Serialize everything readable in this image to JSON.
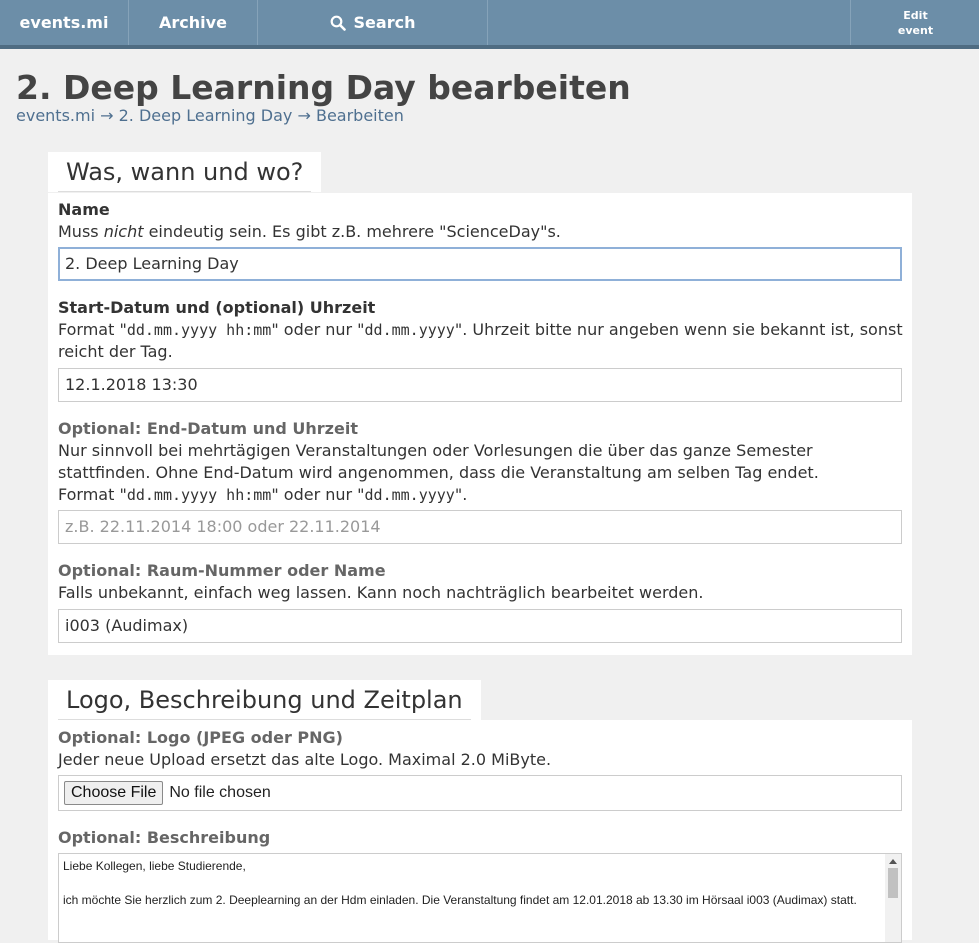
{
  "nav": {
    "brand": "events.mi",
    "archive": "Archive",
    "search": "Search",
    "edit_line1": "Edit",
    "edit_line2": "event"
  },
  "page": {
    "title": "2. Deep Learning Day bearbeiten",
    "breadcrumb": [
      "events.mi",
      "2. Deep Learning Day",
      "Bearbeiten"
    ],
    "breadcrumb_sep": "→"
  },
  "section1": {
    "heading": "Was, wann und wo?",
    "name": {
      "label": "Name",
      "help_pre": "Muss ",
      "help_em": "nicht",
      "help_post": " eindeutig sein. Es gibt z.B. mehrere \"ScienceDay\"s.",
      "value": "2. Deep Learning Day"
    },
    "start": {
      "label": "Start-Datum und (optional) Uhrzeit",
      "help_1": "Format \"",
      "help_code1": "dd.mm.yyyy hh:mm",
      "help_2": "\" oder nur \"",
      "help_code2": "dd.mm.yyyy",
      "help_3": "\". Uhrzeit bitte nur angeben wenn sie bekannt ist, sonst reicht der Tag.",
      "value": "12.1.2018 13:30"
    },
    "end": {
      "label": "Optional: End-Datum und Uhrzeit",
      "help_line1": "Nur sinnvoll bei mehrtägigen Veranstaltungen oder Vorlesungen die über das ganze Semester stattfinden. Ohne End-Datum wird angenommen, dass die Veranstaltung am selben Tag endet.",
      "help_1": "Format \"",
      "help_code1": "dd.mm.yyyy hh:mm",
      "help_2": "\" oder nur \"",
      "help_code2": "dd.mm.yyyy",
      "help_3": "\".",
      "placeholder": "z.B. 22.11.2014 18:00 oder 22.11.2014"
    },
    "room": {
      "label": "Optional: Raum-Nummer oder Name",
      "help": "Falls unbekannt, einfach weg lassen. Kann noch nachträglich bearbeitet werden.",
      "value": "i003 (Audimax)"
    }
  },
  "section2": {
    "heading": "Logo, Beschreibung und Zeitplan",
    "logo": {
      "label": "Optional: Logo (JPEG oder PNG)",
      "help": "Jeder neue Upload ersetzt das alte Logo. Maximal 2.0 MiByte.",
      "button": "Choose File",
      "status": "No file chosen"
    },
    "description": {
      "label": "Optional: Beschreibung",
      "lines": [
        "Liebe Kollegen, liebe Studierende,",
        "",
        "ich möchte Sie herzlich zum 2. Deeplearning an der Hdm einladen. Die Veranstaltung findet am 12.01.2018 ab 13.30 im Hörsaal i003 (Audimax) statt."
      ]
    }
  }
}
